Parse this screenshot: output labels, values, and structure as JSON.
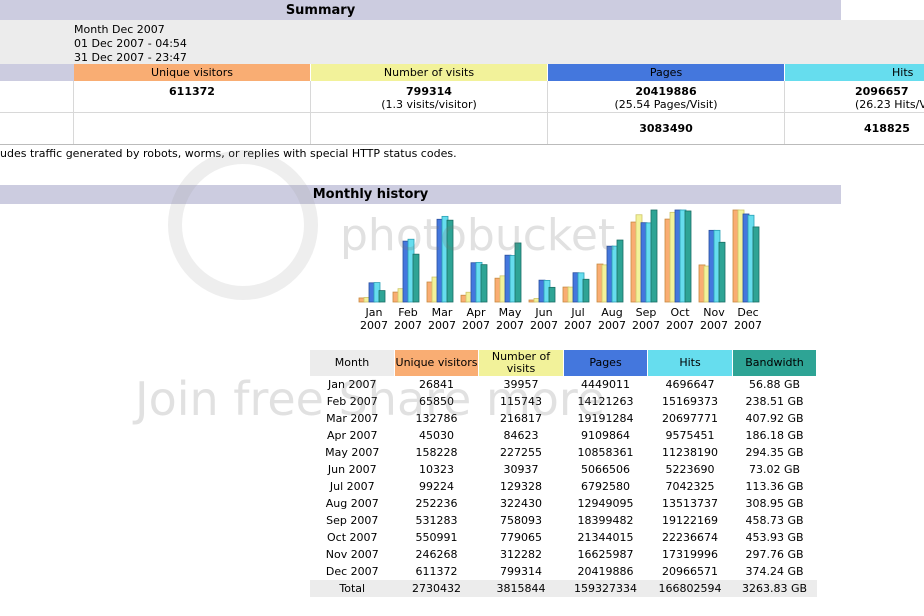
{
  "summary": {
    "title": "Summary",
    "period_label": "Month Dec 2007",
    "first_visit": "01 Dec 2007 - 04:54",
    "last_visit": "31 Dec 2007 - 23:47",
    "columns": [
      "Unique visitors",
      "Number of visits",
      "Pages",
      "Hits"
    ],
    "row1": {
      "unique_visitors": "611372",
      "visits": "799314",
      "visits_sub": "(1.3 visits/visitor)",
      "pages": "20419886",
      "pages_sub": "(25.54 Pages/Visit)",
      "hits": "2096657",
      "hits_sub": "(26.23 Hits/V"
    },
    "row2": {
      "pages": "3083490",
      "hits": "418825"
    },
    "note": "udes traffic generated by robots, worms, or replies with special HTTP status codes."
  },
  "colors": {
    "unique": "#f9ad73",
    "visits": "#f2f29a",
    "pages": "#4477dd",
    "hits": "#66ddee",
    "bandwidth": "#2ea495",
    "header_bg": "#cccce0"
  },
  "monthly": {
    "title": "Monthly history",
    "headers": [
      "Month",
      "Unique visitors",
      "Number of visits",
      "Pages",
      "Hits",
      "Bandwidth"
    ],
    "rows": [
      [
        "Jan 2007",
        "26841",
        "39957",
        "4449011",
        "4696647",
        "56.88 GB"
      ],
      [
        "Feb 2007",
        "65850",
        "115743",
        "14121263",
        "15169373",
        "238.51 GB"
      ],
      [
        "Mar 2007",
        "132786",
        "216817",
        "19191284",
        "20697771",
        "407.92 GB"
      ],
      [
        "Apr 2007",
        "45030",
        "84623",
        "9109864",
        "9575451",
        "186.18 GB"
      ],
      [
        "May 2007",
        "158228",
        "227255",
        "10858361",
        "11238190",
        "294.35 GB"
      ],
      [
        "Jun 2007",
        "10323",
        "30937",
        "5066506",
        "5223690",
        "73.02 GB"
      ],
      [
        "Jul 2007",
        "99224",
        "129328",
        "6792580",
        "7042325",
        "113.36 GB"
      ],
      [
        "Aug 2007",
        "252236",
        "322430",
        "12949095",
        "13513737",
        "308.95 GB"
      ],
      [
        "Sep 2007",
        "531283",
        "758093",
        "18399482",
        "19122169",
        "458.73 GB"
      ],
      [
        "Oct 2007",
        "550991",
        "779065",
        "21344015",
        "22236674",
        "453.93 GB"
      ],
      [
        "Nov 2007",
        "246268",
        "312282",
        "16625987",
        "17319996",
        "297.76 GB"
      ],
      [
        "Dec 2007",
        "611372",
        "799314",
        "20419886",
        "20966571",
        "374.24 GB"
      ]
    ],
    "total": [
      "Total",
      "2730432",
      "3815844",
      "159327334",
      "166802594",
      "3263.83 GB"
    ],
    "chart_months": [
      {
        "m": "Jan",
        "y": "2007"
      },
      {
        "m": "Feb",
        "y": "2007"
      },
      {
        "m": "Mar",
        "y": "2007"
      },
      {
        "m": "Apr",
        "y": "2007"
      },
      {
        "m": "May",
        "y": "2007"
      },
      {
        "m": "Jun",
        "y": "2007"
      },
      {
        "m": "Jul",
        "y": "2007"
      },
      {
        "m": "Aug",
        "y": "2007"
      },
      {
        "m": "Sep",
        "y": "2007"
      },
      {
        "m": "Oct",
        "y": "2007"
      },
      {
        "m": "Nov",
        "y": "2007"
      },
      {
        "m": "Dec",
        "y": "2007"
      }
    ]
  },
  "chart_data": {
    "type": "bar",
    "categories": [
      "Jan 2007",
      "Feb 2007",
      "Mar 2007",
      "Apr 2007",
      "May 2007",
      "Jun 2007",
      "Jul 2007",
      "Aug 2007",
      "Sep 2007",
      "Oct 2007",
      "Nov 2007",
      "Dec 2007"
    ],
    "series": [
      {
        "name": "Unique visitors",
        "values": [
          26841,
          65850,
          132786,
          45030,
          158228,
          10323,
          99224,
          252236,
          531283,
          550991,
          246268,
          611372
        ]
      },
      {
        "name": "Number of visits",
        "values": [
          39957,
          115743,
          216817,
          84623,
          227255,
          30937,
          129328,
          322430,
          758093,
          779065,
          312282,
          799314
        ]
      },
      {
        "name": "Pages",
        "values": [
          4449011,
          14121263,
          19191284,
          9109864,
          10858361,
          5066506,
          6792580,
          12949095,
          18399482,
          21344015,
          16625987,
          20419886
        ]
      },
      {
        "name": "Hits",
        "values": [
          4696647,
          15169373,
          20697771,
          9575451,
          11238190,
          5223690,
          7042325,
          13513737,
          19122169,
          22236674,
          17319996,
          20966571
        ]
      },
      {
        "name": "Bandwidth",
        "values": [
          56.88,
          238.51,
          407.92,
          186.18,
          294.35,
          73.02,
          113.36,
          308.95,
          458.73,
          453.93,
          297.76,
          374.24
        ]
      }
    ]
  },
  "watermark": {
    "top": "photobucket",
    "bottom": "Join free Share more"
  }
}
